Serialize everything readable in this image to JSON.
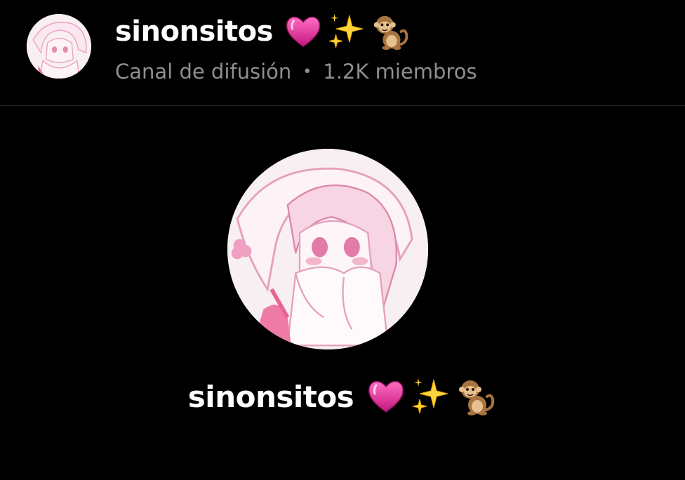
{
  "channel": {
    "name": "sinonsitos",
    "emojis": [
      "heart-icon",
      "sparkles-icon",
      "monkey-icon"
    ],
    "type_label": "Canal de difusión",
    "separator": "•",
    "members_label": "1.2K miembros"
  },
  "colors": {
    "background": "#000000",
    "primary_text": "#ffffff",
    "secondary_text": "#8e8e93",
    "avatar_pink": "#e98fb4"
  }
}
